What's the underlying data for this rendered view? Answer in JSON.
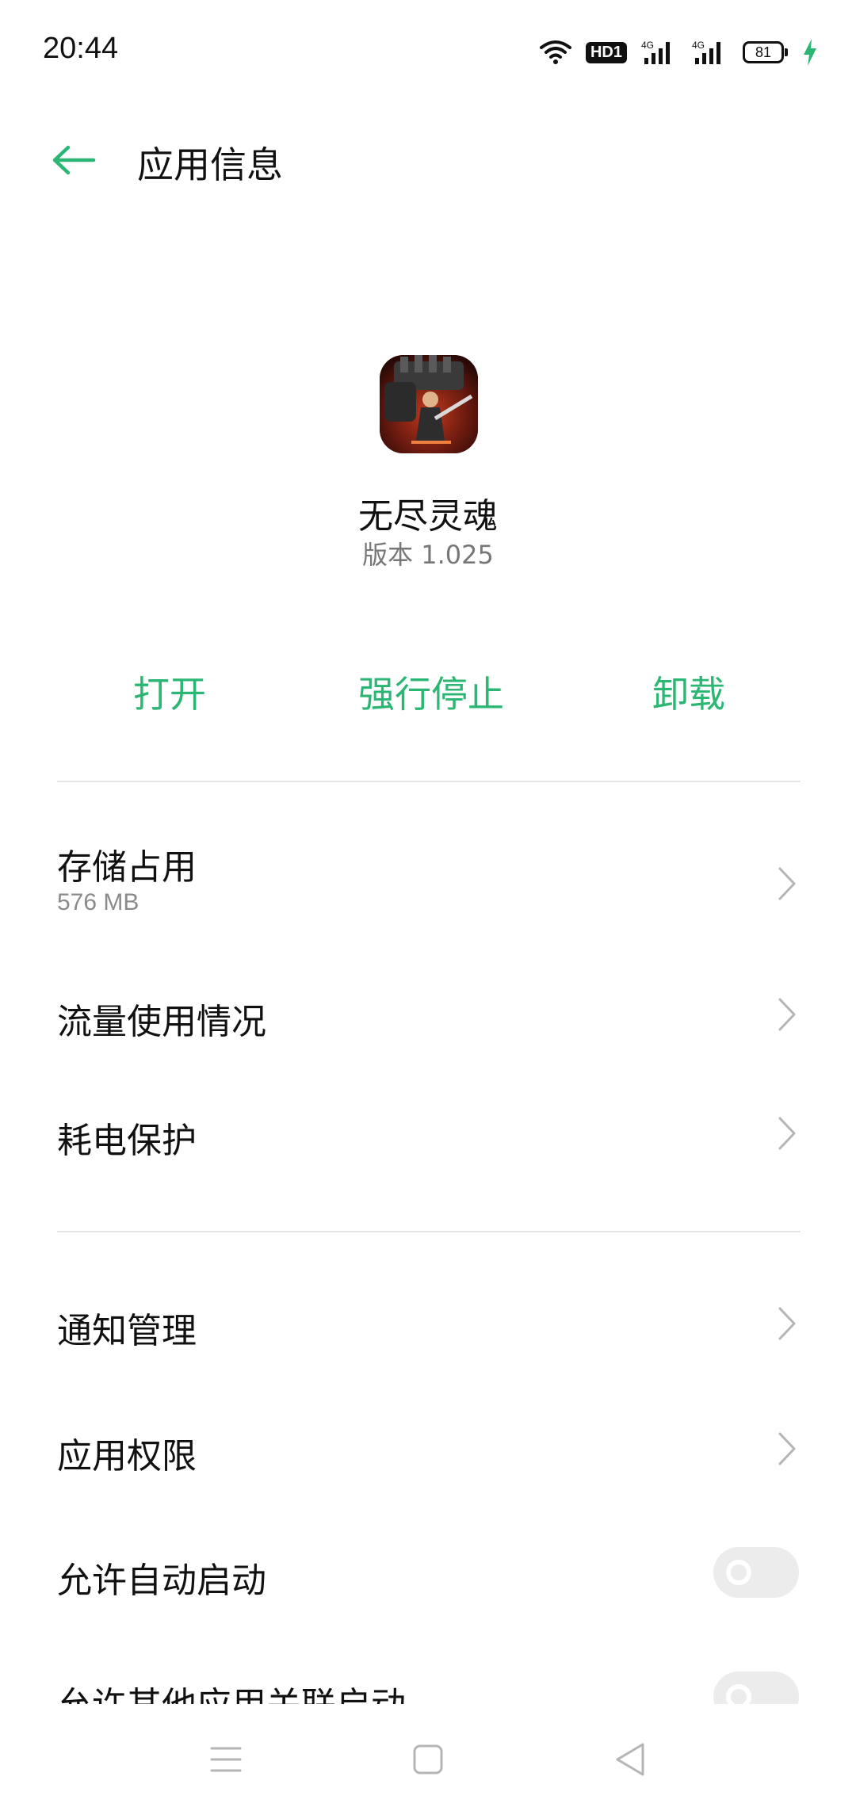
{
  "status_bar": {
    "time": "20:44",
    "hd_label": "HD1",
    "network_1": "4G",
    "network_2": "4G",
    "battery_level": "81",
    "charging": true
  },
  "header": {
    "title": "应用信息",
    "back_icon": "arrow-left-icon"
  },
  "app": {
    "name": "无尽灵魂",
    "version": "版本 1.025"
  },
  "actions": {
    "open": "打开",
    "force_stop": "强行停止",
    "uninstall": "卸载"
  },
  "section_1": [
    {
      "label": "存储占用",
      "sub": "576 MB"
    },
    {
      "label": "流量使用情况"
    },
    {
      "label": "耗电保护"
    }
  ],
  "section_2": [
    {
      "label": "通知管理"
    },
    {
      "label": "应用权限"
    },
    {
      "label": "允许自动启动",
      "toggle": false
    },
    {
      "label": "允许其他应用关联启动",
      "toggle": false
    }
  ],
  "nav_bar": {
    "menu_icon": "menu-icon",
    "home_icon": "home-square-icon",
    "back_icon": "back-triangle-icon"
  },
  "colors": {
    "accent": "#2bb673",
    "divider": "#e6e6e6",
    "secondary_text": "#777777"
  }
}
